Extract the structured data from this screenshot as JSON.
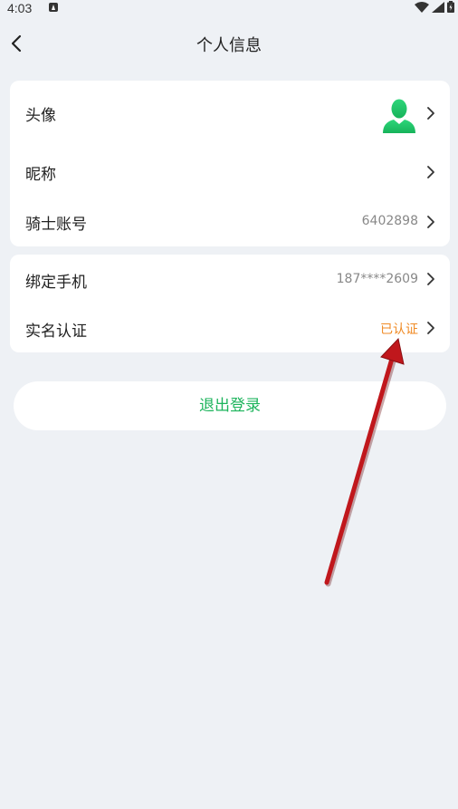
{
  "status_bar": {
    "time": "4:03"
  },
  "header": {
    "title": "个人信息"
  },
  "profile_card": {
    "avatar": {
      "label": "头像",
      "icon": "avatar-icon"
    },
    "nickname": {
      "label": "昵称",
      "value": ""
    },
    "rider_account": {
      "label": "骑士账号",
      "value": "6402898"
    }
  },
  "account_card": {
    "phone": {
      "label": "绑定手机",
      "value": "187****2609"
    },
    "real_name": {
      "label": "实名认证",
      "value": "已认证"
    }
  },
  "logout": {
    "label": "退出登录"
  },
  "colors": {
    "accent_green": "#1db45c",
    "verified_orange": "#f08a24",
    "background": "#eef1f5",
    "annotation_arrow": "#c0171c"
  }
}
